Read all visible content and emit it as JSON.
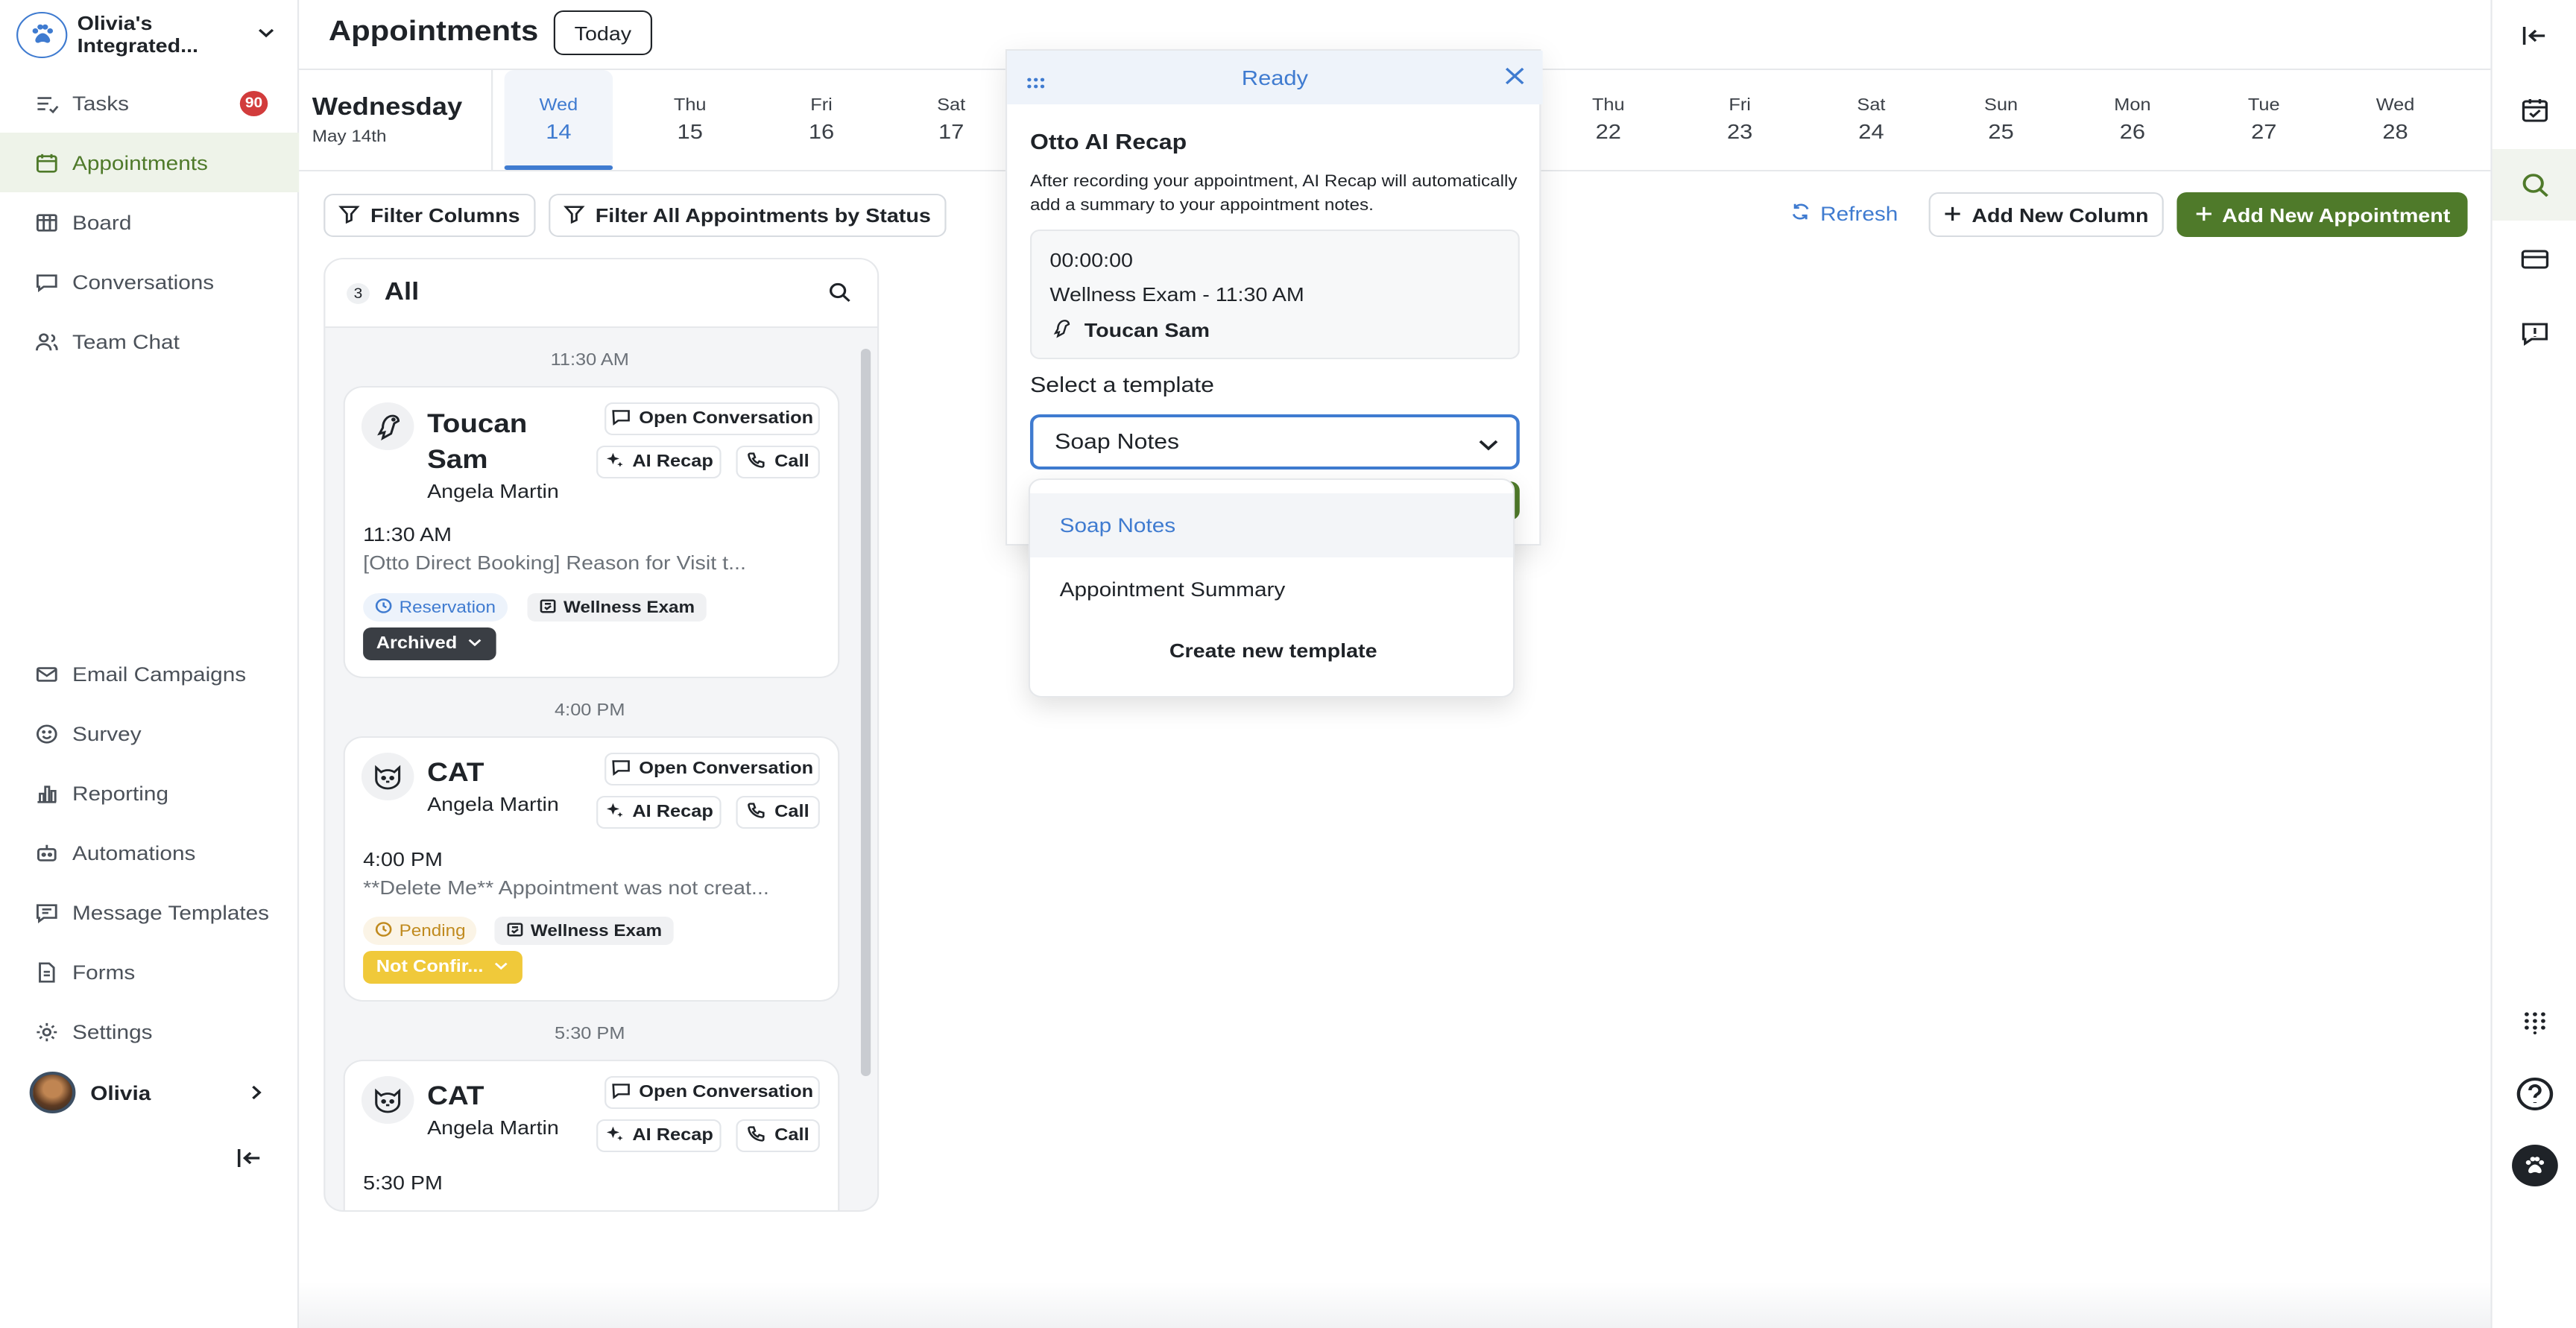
{
  "org": {
    "name": "Olivia's Integrated..."
  },
  "sidebar": {
    "top_items": [
      {
        "label": "Tasks",
        "icon": "tasks-icon",
        "badge": "90"
      },
      {
        "label": "Appointments",
        "icon": "calendar-icon",
        "active": true
      },
      {
        "label": "Board",
        "icon": "board-icon"
      },
      {
        "label": "Conversations",
        "icon": "chat-icon"
      },
      {
        "label": "Team Chat",
        "icon": "team-icon"
      }
    ],
    "bottom_items": [
      {
        "label": "Email Campaigns",
        "icon": "email-icon"
      },
      {
        "label": "Survey",
        "icon": "smile-icon"
      },
      {
        "label": "Reporting",
        "icon": "chart-icon"
      },
      {
        "label": "Automations",
        "icon": "robot-icon"
      },
      {
        "label": "Message Templates",
        "icon": "template-icon"
      },
      {
        "label": "Forms",
        "icon": "form-icon"
      },
      {
        "label": "Settings",
        "icon": "gear-icon"
      }
    ],
    "user": {
      "name": "Olivia"
    }
  },
  "header": {
    "title": "Appointments",
    "today_label": "Today"
  },
  "current_date": {
    "weekday": "Wednesday",
    "month_day": "May 14th"
  },
  "days": [
    {
      "d": "Wed",
      "n": "14",
      "selected": true
    },
    {
      "d": "Thu",
      "n": "15"
    },
    {
      "d": "Fri",
      "n": "16"
    },
    {
      "d": "Sat",
      "n": "17"
    },
    {
      "d": "Thu",
      "n": "22"
    },
    {
      "d": "Fri",
      "n": "23"
    },
    {
      "d": "Sat",
      "n": "24"
    },
    {
      "d": "Sun",
      "n": "25"
    },
    {
      "d": "Mon",
      "n": "26"
    },
    {
      "d": "Tue",
      "n": "27"
    },
    {
      "d": "Wed",
      "n": "28"
    }
  ],
  "toolbar": {
    "filter_columns": "Filter Columns",
    "filter_status": "Filter All Appointments by Status",
    "refresh": "Refresh",
    "add_column": "Add New Column",
    "add_appointment": "Add New Appointment"
  },
  "column": {
    "count": "3",
    "title": "All",
    "groups": [
      {
        "time_header": "11:30 AM",
        "pet": "Toucan Sam",
        "owner": "Angela Martin",
        "time": "11:30 AM",
        "reason": "[Otto Direct Booking] Reason for Visit t...",
        "tag": "Reservation",
        "exam": "Wellness Exam",
        "status": "Archived"
      },
      {
        "time_header": "4:00 PM",
        "pet": "CAT",
        "owner": "Angela Martin",
        "time": "4:00 PM",
        "reason": "**Delete Me** Appointment was not creat...",
        "tag": "Pending",
        "exam": "Wellness Exam",
        "status": "Not Confir..."
      },
      {
        "time_header": "5:30 PM",
        "pet": "CAT",
        "owner": "Angela Martin",
        "time": "5:30 PM"
      }
    ],
    "actions": {
      "open_conversation": "Open Conversation",
      "ai_recap": "AI Recap",
      "call": "Call"
    }
  },
  "recap": {
    "status": "Ready",
    "title": "Otto AI Recap",
    "description": "After recording your appointment, AI Recap will automatically add a summary to your appointment notes.",
    "timer": "00:00:00",
    "appointment": "Wellness Exam - 11:30 AM",
    "pet": "Toucan Sam",
    "select_label": "Select a template",
    "selected": "Soap Notes",
    "options": [
      "Soap Notes",
      "Appointment Summary"
    ],
    "create_label": "Create new template"
  }
}
